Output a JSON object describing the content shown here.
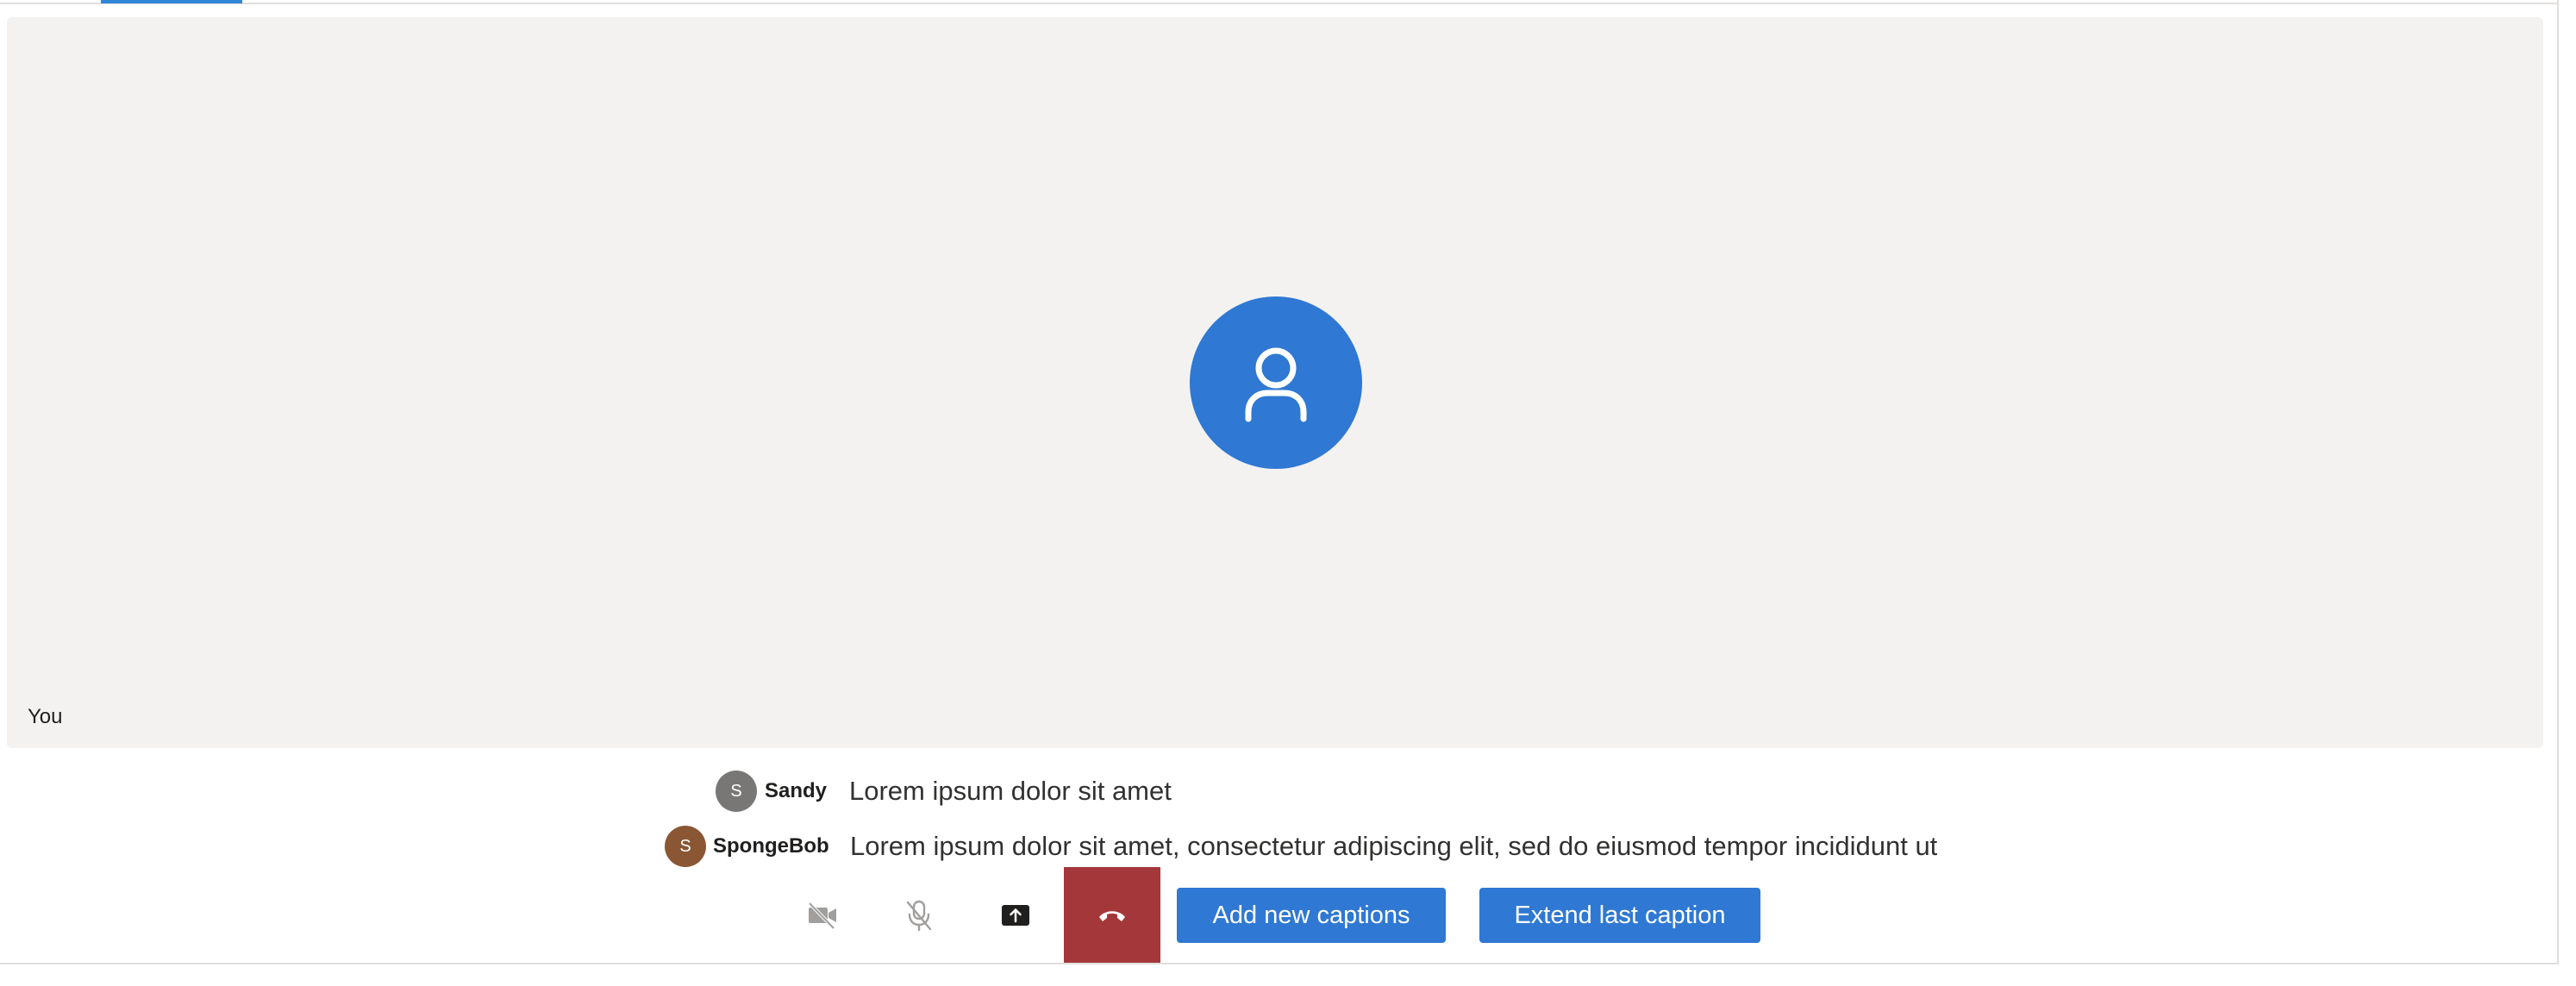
{
  "video": {
    "participant_name": "You",
    "avatar_icon": "person-icon"
  },
  "captions": [
    {
      "initial": "S",
      "speaker": "Sandy",
      "text": "Lorem ipsum dolor sit amet",
      "color": "#797775"
    },
    {
      "initial": "S",
      "speaker": "SpongeBob",
      "text": "Lorem ipsum dolor sit amet, consectetur adipiscing elit, sed do eiusmod tempor incididunt ut",
      "color": "#8a5633"
    }
  ],
  "controls": {
    "camera_icon": "camera-off-icon",
    "mic_icon": "mic-off-icon",
    "share_icon": "share-screen-icon",
    "end_icon": "hang-up-icon",
    "add_captions_label": "Add new captions",
    "extend_caption_label": "Extend last caption"
  },
  "colors": {
    "accent": "#2f78d3",
    "end_call": "#a4373a",
    "tile_bg": "#f3f2f1"
  }
}
